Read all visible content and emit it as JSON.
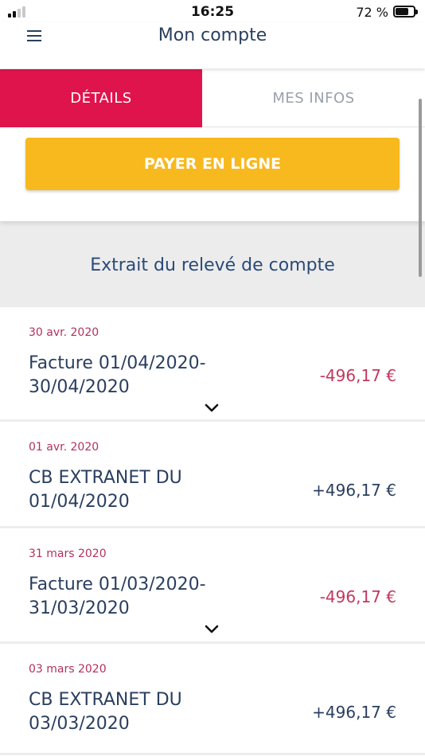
{
  "status_bar": {
    "time": "16:25",
    "battery": "72 %",
    "battery_level": 0.72
  },
  "header": {
    "title": "Mon compte",
    "menu_icon": "hamburger-menu-icon"
  },
  "tabs": [
    {
      "label": "DÉTAILS",
      "active": true
    },
    {
      "label": "MES INFOS",
      "active": false
    }
  ],
  "pay_button": {
    "label": "PAYER EN LIGNE"
  },
  "statement": {
    "title": "Extrait du relevé de compte"
  },
  "transactions": [
    {
      "date": "30 avr. 2020",
      "line1": "Facture 01/04/2020-",
      "line2": "30/04/2020",
      "amount": "-496,17 €",
      "sign": "neg",
      "expandable": true
    },
    {
      "date": "01 avr. 2020",
      "line1": "CB EXTRANET DU",
      "line2": "01/04/2020",
      "amount": "+496,17 €",
      "sign": "pos",
      "expandable": false
    },
    {
      "date": "31 mars 2020",
      "line1": "Facture 01/03/2020-",
      "line2": "31/03/2020",
      "amount": "-496,17 €",
      "sign": "neg",
      "expandable": true
    },
    {
      "date": "03 mars 2020",
      "line1": "CB EXTRANET DU",
      "line2": "03/03/2020",
      "amount": "+496,17 €",
      "sign": "pos",
      "expandable": false
    }
  ],
  "colors": {
    "accent": "#e0144c",
    "pay": "#f8b91e",
    "negative": "#c4375e",
    "text": "#2a3f5f"
  }
}
